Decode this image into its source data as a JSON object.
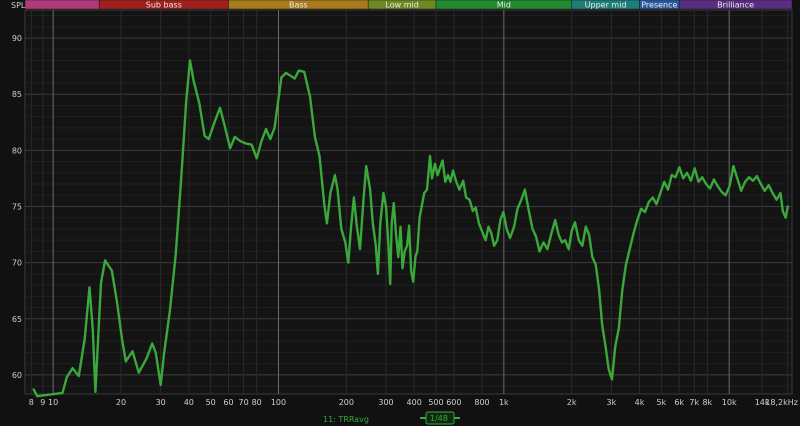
{
  "chart_data": {
    "type": "line",
    "x_scale": "log",
    "y_axis_label": "SPL",
    "xlim": [
      7.5,
      19000
    ],
    "ylim": [
      58.3,
      92.5
    ],
    "grid": true,
    "y_ticks": [
      {
        "value": 60,
        "label": "60"
      },
      {
        "value": 65,
        "label": "65"
      },
      {
        "value": 70,
        "label": "70"
      },
      {
        "value": 75,
        "label": "75"
      },
      {
        "value": 80,
        "label": "80"
      },
      {
        "value": 85,
        "label": "85"
      },
      {
        "value": 90,
        "label": "90"
      }
    ],
    "x_ticks": [
      {
        "value": 8,
        "label": "8"
      },
      {
        "value": 9,
        "label": "9"
      },
      {
        "value": 10,
        "label": "10"
      },
      {
        "value": 20,
        "label": "20"
      },
      {
        "value": 30,
        "label": "30"
      },
      {
        "value": 40,
        "label": "40"
      },
      {
        "value": 50,
        "label": "50"
      },
      {
        "value": 60,
        "label": "60"
      },
      {
        "value": 70,
        "label": "70"
      },
      {
        "value": 80,
        "label": "80"
      },
      {
        "value": 100,
        "label": "100"
      },
      {
        "value": 200,
        "label": "200"
      },
      {
        "value": 300,
        "label": "300"
      },
      {
        "value": 400,
        "label": "400"
      },
      {
        "value": 500,
        "label": "500"
      },
      {
        "value": 600,
        "label": "600"
      },
      {
        "value": 800,
        "label": "800"
      },
      {
        "value": 1000,
        "label": "1k"
      },
      {
        "value": 2000,
        "label": "2k"
      },
      {
        "value": 3000,
        "label": "3k"
      },
      {
        "value": 4000,
        "label": "4k"
      },
      {
        "value": 5000,
        "label": "5k"
      },
      {
        "value": 6000,
        "label": "6k"
      },
      {
        "value": 7000,
        "label": "7k"
      },
      {
        "value": 8000,
        "label": "8k"
      },
      {
        "value": 10000,
        "label": "10k"
      },
      {
        "value": 14000,
        "label": "14k"
      },
      {
        "value": 18200,
        "label": "18,2kHz"
      }
    ],
    "bands": [
      {
        "name": "",
        "from": 7.5,
        "to": 16,
        "color": "#b03a7c"
      },
      {
        "name": "Sub bass",
        "from": 16,
        "to": 60,
        "color": "#a0201e"
      },
      {
        "name": "Bass",
        "from": 60,
        "to": 250,
        "color": "#a87c1c"
      },
      {
        "name": "Low mid",
        "from": 250,
        "to": 500,
        "color": "#6f8a24"
      },
      {
        "name": "Mid",
        "from": 500,
        "to": 2000,
        "color": "#218a2e"
      },
      {
        "name": "Upper mid",
        "from": 2000,
        "to": 4000,
        "color": "#1e7e7a"
      },
      {
        "name": "Presence",
        "from": 4000,
        "to": 6000,
        "color": "#2a5ba0"
      },
      {
        "name": "Brilliance",
        "from": 6000,
        "to": 19000,
        "color": "#5a2c82"
      }
    ],
    "series": [
      {
        "name": "11: TRRavg",
        "color": "#3aa83a",
        "points": [
          [
            8.2,
            58.7
          ],
          [
            8.5,
            58.1
          ],
          [
            11.0,
            58.4
          ],
          [
            11.5,
            59.8
          ],
          [
            12.2,
            60.6
          ],
          [
            13.0,
            59.9
          ],
          [
            13.8,
            63.2
          ],
          [
            14.5,
            67.8
          ],
          [
            15.0,
            64.0
          ],
          [
            15.4,
            58.5
          ],
          [
            16.3,
            68.2
          ],
          [
            17.0,
            70.2
          ],
          [
            18.2,
            69.3
          ],
          [
            19.2,
            66.5
          ],
          [
            20.2,
            63.2
          ],
          [
            21.0,
            61.2
          ],
          [
            22.5,
            62.1
          ],
          [
            24.0,
            60.2
          ],
          [
            26.0,
            61.5
          ],
          [
            27.5,
            62.8
          ],
          [
            28.5,
            62.0
          ],
          [
            30.0,
            59.1
          ],
          [
            31.0,
            61.8
          ],
          [
            33.0,
            65.8
          ],
          [
            35.0,
            70.8
          ],
          [
            37.0,
            77.5
          ],
          [
            39.0,
            84.5
          ],
          [
            40.5,
            88.0
          ],
          [
            42.0,
            86.2
          ],
          [
            44.5,
            84.2
          ],
          [
            47.0,
            81.3
          ],
          [
            49.0,
            81.0
          ],
          [
            52.0,
            82.5
          ],
          [
            55.0,
            83.8
          ],
          [
            58.0,
            82.0
          ],
          [
            61.0,
            80.2
          ],
          [
            64.0,
            81.2
          ],
          [
            68.0,
            80.8
          ],
          [
            72.0,
            80.6
          ],
          [
            76.0,
            80.5
          ],
          [
            80.0,
            79.3
          ],
          [
            84.0,
            80.8
          ],
          [
            88.0,
            81.9
          ],
          [
            92.0,
            81.0
          ],
          [
            96.0,
            82.0
          ],
          [
            103.0,
            86.5
          ],
          [
            108.0,
            86.9
          ],
          [
            118.0,
            86.4
          ],
          [
            123.0,
            87.1
          ],
          [
            130.0,
            87.0
          ],
          [
            138.0,
            84.8
          ],
          [
            145.0,
            81.2
          ],
          [
            152.0,
            79.5
          ],
          [
            160.0,
            75.0
          ],
          [
            164.0,
            73.5
          ],
          [
            170.0,
            76.2
          ],
          [
            178.0,
            77.8
          ],
          [
            183.0,
            76.5
          ],
          [
            190.0,
            73.0
          ],
          [
            198.0,
            71.8
          ],
          [
            204.0,
            70.0
          ],
          [
            210.0,
            73.2
          ],
          [
            216.0,
            75.8
          ],
          [
            222.0,
            73.5
          ],
          [
            230.0,
            71.2
          ],
          [
            238.0,
            75.5
          ],
          [
            245.0,
            78.6
          ],
          [
            255.0,
            76.5
          ],
          [
            262.0,
            73.5
          ],
          [
            270.0,
            71.6
          ],
          [
            276.0,
            69.0
          ],
          [
            283.0,
            73.5
          ],
          [
            292.0,
            76.2
          ],
          [
            300.0,
            75.0
          ],
          [
            307.0,
            71.8
          ],
          [
            313.0,
            68.1
          ],
          [
            318.0,
            73.5
          ],
          [
            325.0,
            75.3
          ],
          [
            333.0,
            72.3
          ],
          [
            340.0,
            70.5
          ],
          [
            348.0,
            73.2
          ],
          [
            355.0,
            69.5
          ],
          [
            363.0,
            71.0
          ],
          [
            372.0,
            71.5
          ],
          [
            380.0,
            73.3
          ],
          [
            388.0,
            69.2
          ],
          [
            396.0,
            68.3
          ],
          [
            405.0,
            70.5
          ],
          [
            413.0,
            71.0
          ],
          [
            423.0,
            74.0
          ],
          [
            433.0,
            75.1
          ],
          [
            443.0,
            76.2
          ],
          [
            456.0,
            76.5
          ],
          [
            470.0,
            79.5
          ],
          [
            480.0,
            77.5
          ],
          [
            495.0,
            78.8
          ],
          [
            508.0,
            77.8
          ],
          [
            522.0,
            78.5
          ],
          [
            535.0,
            79.1
          ],
          [
            550.0,
            77.2
          ],
          [
            565.0,
            77.8
          ],
          [
            580.0,
            77.2
          ],
          [
            595.0,
            78.2
          ],
          [
            615.0,
            77.2
          ],
          [
            635.0,
            76.5
          ],
          [
            660.0,
            77.3
          ],
          [
            680.0,
            75.8
          ],
          [
            705.0,
            75.6
          ],
          [
            728.0,
            74.6
          ],
          [
            750.0,
            74.9
          ],
          [
            775.0,
            73.5
          ],
          [
            800.0,
            72.8
          ],
          [
            830.0,
            72.0
          ],
          [
            855.0,
            73.2
          ],
          [
            880.0,
            72.6
          ],
          [
            905.0,
            71.5
          ],
          [
            935.0,
            72.0
          ],
          [
            965.0,
            73.8
          ],
          [
            995.0,
            74.5
          ],
          [
            1030.0,
            73.0
          ],
          [
            1065.0,
            72.2
          ],
          [
            1110.0,
            73.2
          ],
          [
            1150.0,
            74.8
          ],
          [
            1195.0,
            75.6
          ],
          [
            1240.0,
            76.5
          ],
          [
            1285.0,
            74.8
          ],
          [
            1340.0,
            73.0
          ],
          [
            1390.0,
            72.3
          ],
          [
            1440.0,
            71.0
          ],
          [
            1500.0,
            71.8
          ],
          [
            1560.0,
            71.2
          ],
          [
            1620.0,
            72.5
          ],
          [
            1690.0,
            73.8
          ],
          [
            1750.0,
            72.5
          ],
          [
            1810.0,
            71.8
          ],
          [
            1870.0,
            72.0
          ],
          [
            1940.0,
            71.2
          ],
          [
            2000.0,
            72.8
          ],
          [
            2070.0,
            73.6
          ],
          [
            2150.0,
            72.0
          ],
          [
            2230.0,
            71.5
          ],
          [
            2310.0,
            73.2
          ],
          [
            2390.0,
            72.5
          ],
          [
            2470.0,
            70.5
          ],
          [
            2560.0,
            69.8
          ],
          [
            2650.0,
            67.5
          ],
          [
            2730.0,
            64.5
          ],
          [
            2830.0,
            62.5
          ],
          [
            2920.0,
            60.5
          ],
          [
            3020.0,
            59.6
          ],
          [
            3120.0,
            62.5
          ],
          [
            3240.0,
            64.2
          ],
          [
            3350.0,
            67.5
          ],
          [
            3480.0,
            69.8
          ],
          [
            3620.0,
            71.2
          ],
          [
            3760.0,
            72.6
          ],
          [
            3910.0,
            73.8
          ],
          [
            4070.0,
            74.8
          ],
          [
            4230.0,
            74.5
          ],
          [
            4400.0,
            75.4
          ],
          [
            4580.0,
            75.8
          ],
          [
            4760.0,
            75.2
          ],
          [
            4950.0,
            76.2
          ],
          [
            5150.0,
            77.2
          ],
          [
            5350.0,
            76.5
          ],
          [
            5560.0,
            77.8
          ],
          [
            5780.0,
            77.6
          ],
          [
            6010.0,
            78.5
          ],
          [
            6250.0,
            77.5
          ],
          [
            6500.0,
            78.0
          ],
          [
            6760.0,
            77.3
          ],
          [
            7030.0,
            78.4
          ],
          [
            7310.0,
            77.2
          ],
          [
            7600.0,
            77.6
          ],
          [
            7900.0,
            77.0
          ],
          [
            8220.0,
            76.6
          ],
          [
            8550.0,
            77.4
          ],
          [
            8900.0,
            76.8
          ],
          [
            9260.0,
            76.3
          ],
          [
            9640.0,
            76.0
          ],
          [
            10030.0,
            76.8
          ],
          [
            10440.0,
            78.6
          ],
          [
            10870.0,
            77.5
          ],
          [
            11310.0,
            76.4
          ],
          [
            11770.0,
            77.2
          ],
          [
            12250.0,
            77.6
          ],
          [
            12750.0,
            77.3
          ],
          [
            13270.0,
            77.7
          ],
          [
            13810.0,
            77.0
          ],
          [
            14380.0,
            76.4
          ],
          [
            14970.0,
            76.9
          ],
          [
            15590.0,
            76.2
          ],
          [
            16230.0,
            75.6
          ],
          [
            16900.0,
            76.2
          ],
          [
            17300.0,
            74.6
          ],
          [
            17800.0,
            74.0
          ],
          [
            18200.0,
            75.0
          ]
        ]
      }
    ]
  },
  "legend": {
    "series_label": "11: TRRavg",
    "smoothing_label": "1/48"
  }
}
